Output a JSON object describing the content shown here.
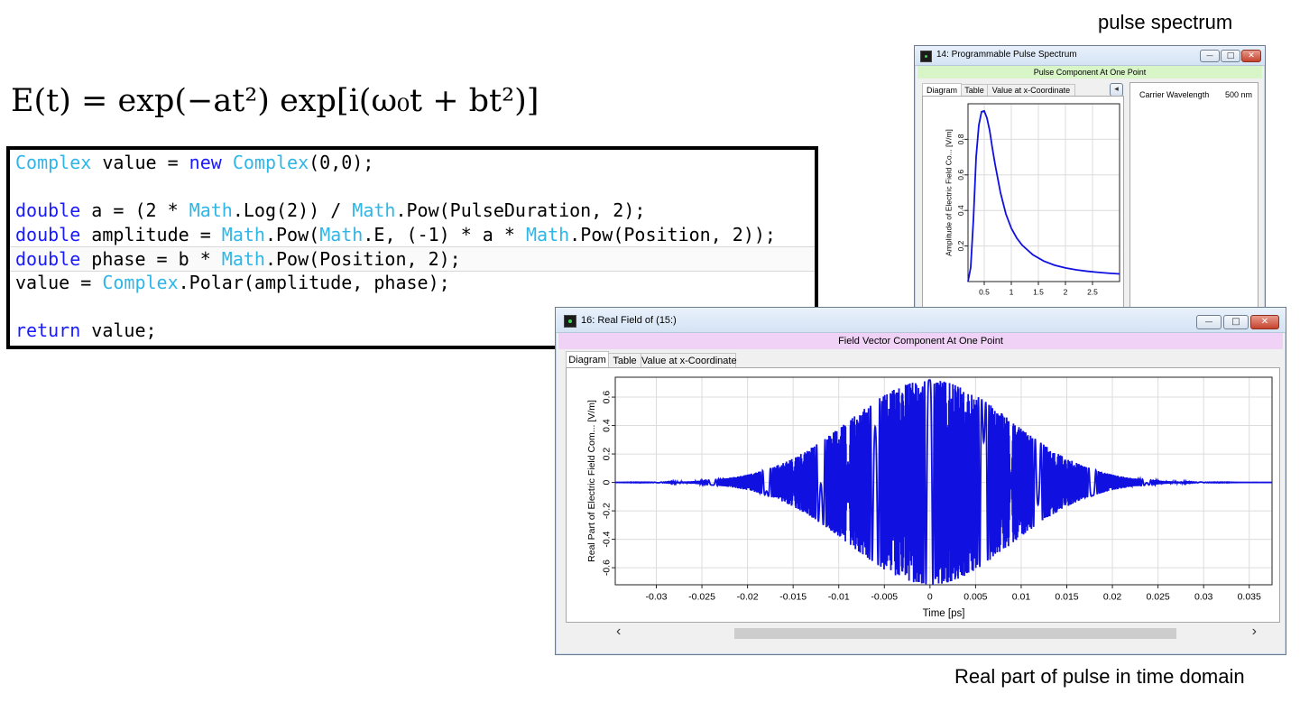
{
  "captions": {
    "spectrum": "pulse spectrum",
    "time_domain": "Real part of pulse in time domain"
  },
  "formula": "E(t) = exp(−at²) exp[i(ω₀t + bt²)]",
  "code": {
    "lines": [
      [
        {
          "t": "Complex",
          "c": "ty"
        },
        {
          "t": " value = "
        },
        {
          "t": "new",
          "c": "kw"
        },
        {
          "t": " "
        },
        {
          "t": "Complex",
          "c": "ty"
        },
        {
          "t": "(0,0);"
        }
      ],
      [],
      [
        {
          "t": "double",
          "c": "kw"
        },
        {
          "t": " a = (2 * "
        },
        {
          "t": "Math",
          "c": "ty"
        },
        {
          "t": ".Log(2)) / "
        },
        {
          "t": "Math",
          "c": "ty"
        },
        {
          "t": ".Pow(PulseDuration, 2);"
        }
      ],
      [
        {
          "t": "double",
          "c": "kw"
        },
        {
          "t": " amplitude = "
        },
        {
          "t": "Math",
          "c": "ty"
        },
        {
          "t": ".Pow("
        },
        {
          "t": "Math",
          "c": "ty"
        },
        {
          "t": ".E, (-1) * a * "
        },
        {
          "t": "Math",
          "c": "ty"
        },
        {
          "t": ".Pow(Position, 2));"
        }
      ],
      [
        {
          "t": "double",
          "c": "kw"
        },
        {
          "t": " phase = b * "
        },
        {
          "t": "Math",
          "c": "ty"
        },
        {
          "t": ".Pow(Position, 2);"
        }
      ],
      [
        {
          "t": "value = "
        },
        {
          "t": "Complex",
          "c": "ty"
        },
        {
          "t": ".Polar(amplitude, phase);"
        }
      ],
      [],
      [
        {
          "t": "return",
          "c": "kw"
        },
        {
          "t": " value;"
        }
      ]
    ],
    "highlighted_line": 4
  },
  "spectrum_window": {
    "title": "14: Programmable Pulse Spectrum",
    "band": "Pulse Component At One Point",
    "tabs": [
      "Diagram",
      "Table",
      "Value at x-Coordinate"
    ],
    "active_tab": "Diagram",
    "panel_toggle": "◂",
    "carrier_label": "Carrier Wavelength",
    "carrier_value": "500 nm",
    "band_color": "#d8f5c8"
  },
  "field_window": {
    "title": "16: Real Field of (15:)",
    "band": "Field Vector Component At One Point",
    "tabs": [
      "Diagram",
      "Table",
      "Value at x-Coordinate"
    ],
    "active_tab": "Diagram",
    "scroll_left": "‹",
    "scroll_right": "›",
    "band_color": "#f0d2f6"
  },
  "window_buttons": {
    "minimize": "—",
    "maximize": "□",
    "close": "✕"
  },
  "chart_data": [
    {
      "type": "line",
      "title": "",
      "xlabel": "",
      "ylabel": "Amplitude of Electric Field Co... [V/m]",
      "x_ticks": [
        0.5,
        1,
        1.5,
        2,
        2.5
      ],
      "x_tick_labels": [
        "0.5",
        "1",
        "1.5",
        "2",
        "2.5"
      ],
      "y_ticks": [
        0.2,
        0.4,
        0.6,
        0.8
      ],
      "y_tick_labels": [
        "0.2",
        "0.4",
        "0.6",
        "0.8"
      ],
      "xlim": [
        0.2,
        3.0
      ],
      "ylim": [
        0,
        1.0
      ],
      "grid": true,
      "line_color": "#1010e0",
      "series": [
        {
          "x": [
            0.2,
            0.25,
            0.3,
            0.35,
            0.4,
            0.45,
            0.5,
            0.55,
            0.6,
            0.65,
            0.7,
            0.8,
            0.9,
            1.0,
            1.1,
            1.2,
            1.4,
            1.6,
            1.8,
            2.0,
            2.2,
            2.4,
            2.6,
            2.8,
            3.0
          ],
          "y": [
            0.0,
            0.08,
            0.35,
            0.7,
            0.88,
            0.955,
            0.96,
            0.92,
            0.85,
            0.75,
            0.66,
            0.5,
            0.38,
            0.3,
            0.245,
            0.205,
            0.15,
            0.115,
            0.092,
            0.077,
            0.066,
            0.058,
            0.052,
            0.047,
            0.043
          ]
        }
      ]
    },
    {
      "type": "line",
      "title": "",
      "xlabel": "Time [ps]",
      "ylabel": "Real Part of Electric Field Com... [V/m]",
      "x_ticks": [
        -0.03,
        -0.025,
        -0.02,
        -0.015,
        -0.01,
        -0.005,
        0,
        0.005,
        0.01,
        0.015,
        0.02,
        0.025,
        0.03,
        0.035
      ],
      "x_tick_labels": [
        "-0.03",
        "-0.025",
        "-0.02",
        "-0.015",
        "-0.01",
        "-0.005",
        "0",
        "0.005",
        "0.01",
        "0.015",
        "0.02",
        "0.025",
        "0.03",
        "0.035"
      ],
      "y_ticks": [
        -0.6,
        -0.4,
        -0.2,
        0,
        0.2,
        0.4,
        0.6
      ],
      "y_tick_labels": [
        "-0.6",
        "-0.4",
        "-0.2",
        "0",
        "0.2",
        "0.4",
        "0.6"
      ],
      "xlim": [
        -0.0345,
        0.0375
      ],
      "ylim": [
        -0.72,
        0.74
      ],
      "grid": true,
      "line_color": "#1010e0",
      "series": [
        {
          "function": "real part of chirped Gaussian pulse",
          "amplitude": 0.72,
          "gaussian_width_ps": 0.0125,
          "center_ps": 0.0,
          "cycles_per_ps_at_center": 395,
          "chirp_per_ps2": 3500000
        }
      ]
    }
  ]
}
